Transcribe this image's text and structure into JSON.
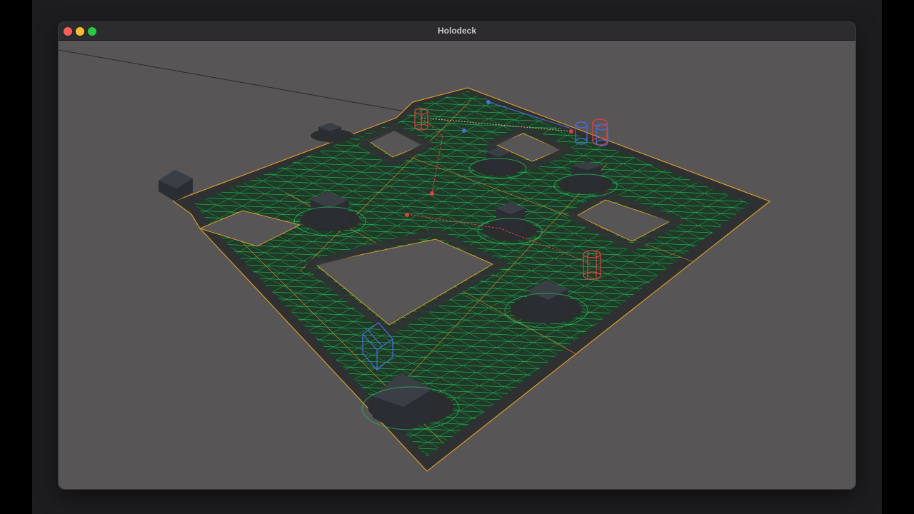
{
  "window": {
    "title": "Holodeck",
    "controls": [
      {
        "name": "close",
        "color": "#ff5f57"
      },
      {
        "name": "minimize",
        "color": "#febc2e"
      },
      {
        "name": "maximize",
        "color": "#28c840"
      }
    ]
  },
  "scene": {
    "background_color": "#575556",
    "floor_color": "#303233",
    "navmesh_color": "#22c55e",
    "edge_color": "#e0a030",
    "obstacle_color": "#2a2e33",
    "agent_colors": {
      "red": "#e04040",
      "blue": "#4a6fe0"
    },
    "obstacle_count": 9,
    "agent_count": 5
  }
}
